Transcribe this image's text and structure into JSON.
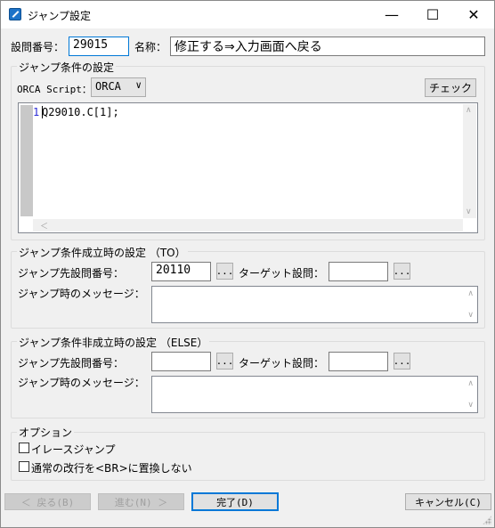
{
  "window": {
    "title": "ジャンプ設定",
    "minimize_glyph": "—",
    "maximize_glyph": "☐",
    "close_glyph": "✕"
  },
  "header": {
    "question_no_label": "設問番号：",
    "question_no_value": "29015",
    "name_label": "名称：",
    "name_value": "修正する⇒入力画面へ戻る"
  },
  "condition": {
    "group_title": "ジャンプ条件の設定",
    "script_label": "ORCA Script：",
    "script_select": "ORCA",
    "check_button": "チェック",
    "line_number": "1",
    "code": "Q29010.C[1];"
  },
  "then_section": {
    "group_title": "ジャンプ条件成立時の設定 （TO）",
    "dest_label": "ジャンプ先設問番号：",
    "dest_value": "20110",
    "browse_label": "...",
    "target_label": "ターゲット設問：",
    "target_value": "",
    "browse2_label": "...",
    "message_label": "ジャンプ時のメッセージ："
  },
  "else_section": {
    "group_title": "ジャンプ条件非成立時の設定 （ELSE）",
    "dest_label": "ジャンプ先設問番号：",
    "dest_value": "",
    "browse_label": "...",
    "target_label": "ターゲット設問：",
    "target_value": "",
    "browse2_label": "...",
    "message_label": "ジャンプ時のメッセージ："
  },
  "options": {
    "group_title": "オプション",
    "erase_jump_label": "イレースジャンプ",
    "erase_jump_checked": false,
    "br_replace_label": "通常の改行を<BR>に置換しない",
    "br_replace_checked": false
  },
  "footer": {
    "back_label": "＜ 戻る(B)",
    "next_label": "進む(N) ＞",
    "finish_label": "完了(D)",
    "cancel_label": "キャンセル(C)"
  }
}
